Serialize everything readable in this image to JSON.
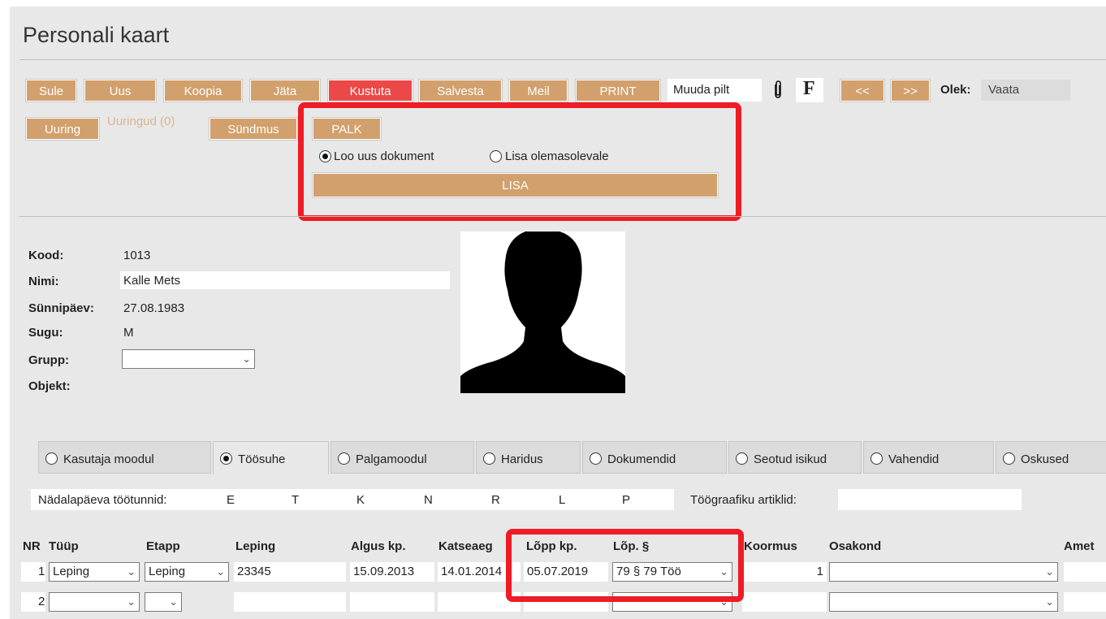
{
  "page": {
    "title": "Personali kaart"
  },
  "toolbar": {
    "sule": "Sule",
    "uus": "Uus",
    "koopia": "Koopia",
    "jata": "Jäta",
    "kustuta": "Kustuta",
    "salvesta": "Salvesta",
    "meil": "Meil",
    "print": "PRINT",
    "muuda_pilt": "Muuda pilt",
    "f_label": "F",
    "prev": "<<",
    "next": ">>",
    "olek_label": "Olek:",
    "olek_value": "Vaata",
    "uuring": "Uuring",
    "uuringud": "Uuringud (0)",
    "sundmus": "Sündmus",
    "palk": "PALK",
    "radio_new": "Loo uus dokument",
    "radio_existing": "Lisa olemasolevale",
    "lisa": "LISA"
  },
  "person": {
    "kood_label": "Kood:",
    "kood": "1013",
    "nimi_label": "Nimi:",
    "nimi": "Kalle Mets",
    "synnipaev_label": "Sünnipäev:",
    "synnipaev": "27.08.1983",
    "sugu_label": "Sugu:",
    "sugu": "M",
    "grupp_label": "Grupp:",
    "grupp": "",
    "objekt_label": "Objekt:"
  },
  "tabs": [
    {
      "label": "Kasutaja moodul",
      "active": false
    },
    {
      "label": "Töösuhe",
      "active": true
    },
    {
      "label": "Palgamoodul",
      "active": false
    },
    {
      "label": "Haridus",
      "active": false
    },
    {
      "label": "Dokumendid",
      "active": false
    },
    {
      "label": "Seotud isikud",
      "active": false
    },
    {
      "label": "Vahendid",
      "active": false
    },
    {
      "label": "Oskused",
      "active": false
    }
  ],
  "weekhours": {
    "label": "Nädalapäeva töötunnid:",
    "days": [
      "E",
      "T",
      "K",
      "N",
      "R",
      "L",
      "P"
    ],
    "artiklid_label": "Töögraafiku artiklid:"
  },
  "table": {
    "headers": [
      "NR",
      "Tüüp",
      "Etapp",
      "Leping",
      "Algus kp.",
      "Katseaeg",
      "Lõpp kp.",
      "Lõp. §",
      "Koormus",
      "Osakond",
      "Amet"
    ],
    "rows": [
      {
        "nr": "1",
        "tyyp": "Leping",
        "etapp": "Leping",
        "leping": "23345",
        "algus": "15.09.2013",
        "katseaeg": "14.01.2014",
        "lopp": "05.07.2019",
        "lop_par": "79 § 79 Töö",
        "koormus": "1",
        "osakond": ""
      },
      {
        "nr": "2",
        "tyyp": "",
        "etapp": "",
        "leping": "",
        "algus": "",
        "katseaeg": "",
        "lopp": "",
        "lop_par": "",
        "koormus": "",
        "osakond": ""
      }
    ]
  },
  "colors": {
    "button": "#d2a06c",
    "button_delete": "#ec4848",
    "highlight": "#ee1c25",
    "panel": "#e8e8e8"
  },
  "icons": {
    "attach": "paperclip-icon",
    "dropdown": "chevron-down-icon",
    "photo": "person-silhouette"
  }
}
